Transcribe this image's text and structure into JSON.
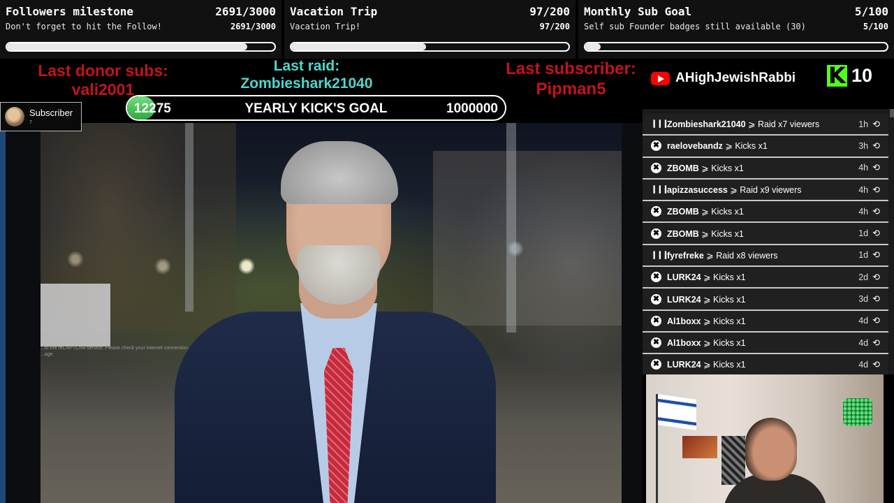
{
  "goals": [
    {
      "title": "Followers milestone",
      "count": "2691/3000",
      "subtitle": "Don't forget to hit the Follow!",
      "count_small": "2691/3000",
      "progress": 0.897
    },
    {
      "title": "Vacation Trip",
      "count": "97/200",
      "subtitle": "Vacation Trip!",
      "count_small": "97/200",
      "progress": 0.485
    },
    {
      "title": "Monthly Sub Goal",
      "count": "5/100",
      "subtitle": "Self sub Founder badges still available (30)",
      "count_small": "5/100",
      "progress": 0.05
    }
  ],
  "overlay": {
    "last_donor_label": "Last donor subs:",
    "last_donor_name": "vali2001",
    "last_raid_label": "Last raid:",
    "last_raid_name": "Zombieshark21040",
    "last_sub_label": "Last subscriber:",
    "last_sub_name": "Pipman5",
    "yearly_goal": {
      "current": "12275",
      "label": "YEARLY KICK'S GOAL",
      "target": "1000000",
      "progress": 0.012
    },
    "channel_name": "AHighJewishRabbi",
    "channel_icon": "youtube-icon",
    "kick_icon": "kick-logo-icon",
    "kick_count": "10"
  },
  "subscriber_badge": {
    "label": "Subscriber",
    "count": "7"
  },
  "main_video": {
    "captcha_text_1": "...to the reCAPTCHA service. Please check your internet connection",
    "captcha_text_2": "...age."
  },
  "events": [
    {
      "type": "raid",
      "icon": "raid-icon",
      "user": "Zombieshark21040",
      "action": "Raid x7 viewers",
      "time": "1h"
    },
    {
      "type": "kick",
      "icon": "kick-icon",
      "user": "raelovebandz",
      "action": "Kicks x1",
      "time": "3h"
    },
    {
      "type": "kick",
      "icon": "kick-icon",
      "user": "ZBOMB",
      "action": "Kicks x1",
      "time": "4h"
    },
    {
      "type": "raid",
      "icon": "raid-icon",
      "user": "apizzasuccess",
      "action": "Raid x9 viewers",
      "time": "4h"
    },
    {
      "type": "kick",
      "icon": "kick-icon",
      "user": "ZBOMB",
      "action": "Kicks x1",
      "time": "4h"
    },
    {
      "type": "kick",
      "icon": "kick-icon",
      "user": "ZBOMB",
      "action": "Kicks x1",
      "time": "1d"
    },
    {
      "type": "raid",
      "icon": "raid-icon",
      "user": "fyrefreke",
      "action": "Raid x8 viewers",
      "time": "1d"
    },
    {
      "type": "kick",
      "icon": "kick-icon",
      "user": "LURK24",
      "action": "Kicks x1",
      "time": "2d"
    },
    {
      "type": "kick",
      "icon": "kick-icon",
      "user": "LURK24",
      "action": "Kicks x1",
      "time": "3d"
    },
    {
      "type": "kick",
      "icon": "kick-icon",
      "user": "Al1boxx",
      "action": "Kicks x1",
      "time": "4d"
    },
    {
      "type": "kick",
      "icon": "kick-icon",
      "user": "Al1boxx",
      "action": "Kicks x1",
      "time": "4d"
    },
    {
      "type": "kick",
      "icon": "kick-icon",
      "user": "LURK24",
      "action": "Kicks x1",
      "time": "4d"
    }
  ],
  "colors": {
    "red": "#c2141c",
    "cyan": "#4fd6cf",
    "kick_green": "#53fc18",
    "youtube_red": "#ff0000",
    "progress_green": "#2fa83f"
  }
}
